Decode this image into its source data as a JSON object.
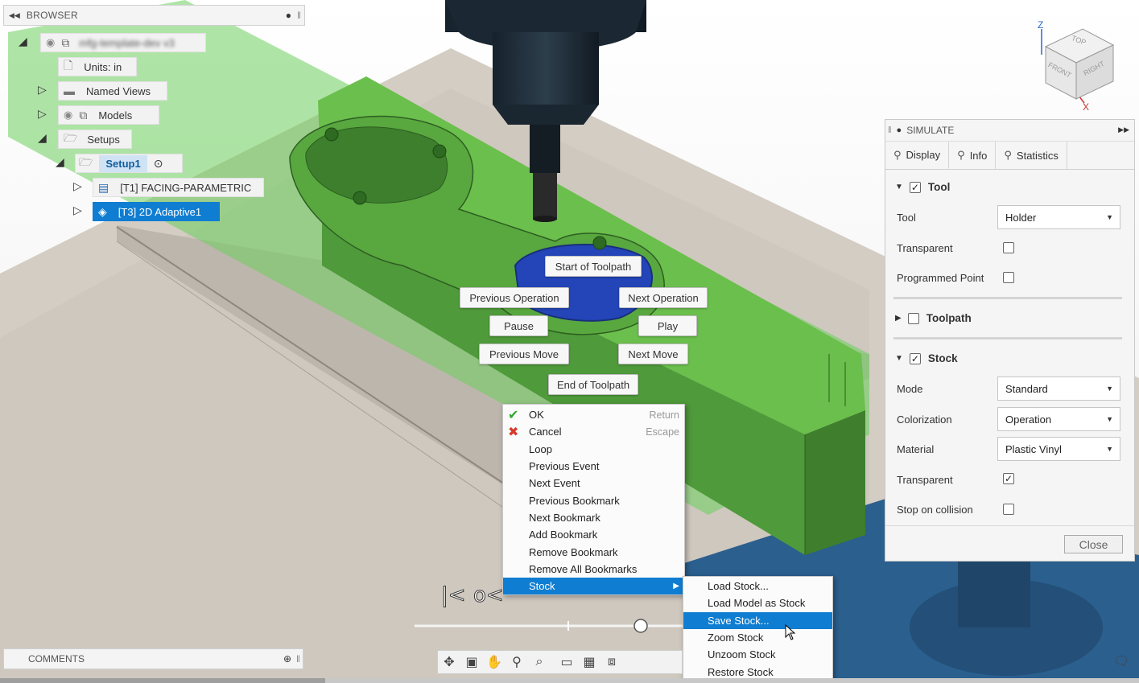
{
  "browser": {
    "title": "BROWSER",
    "root_label": "mfg-template-dev v3",
    "units_label": "Units: in",
    "named_views_label": "Named Views",
    "models_label": "Models",
    "setups_label": "Setups",
    "setup1_label": "Setup1",
    "op1_label": "[T1] FACING-PARAMETRIC",
    "op2_label": "[T3] 2D Adaptive1"
  },
  "hud": {
    "start_of_toolpath": "Start of Toolpath",
    "previous_operation": "Previous Operation",
    "next_operation": "Next Operation",
    "pause": "Pause",
    "play": "Play",
    "previous_move": "Previous Move",
    "next_move": "Next Move",
    "end_of_toolpath": "End of Toolpath"
  },
  "context_menu": {
    "items": [
      {
        "label": "OK",
        "shortcut": "Return"
      },
      {
        "label": "Cancel",
        "shortcut": "Escape"
      },
      {
        "label": "Loop"
      },
      {
        "label": "Previous Event"
      },
      {
        "label": "Next Event"
      },
      {
        "label": "Previous Bookmark"
      },
      {
        "label": "Next Bookmark"
      },
      {
        "label": "Add Bookmark"
      },
      {
        "label": "Remove Bookmark"
      },
      {
        "label": "Remove All Bookmarks"
      },
      {
        "label": "Stock"
      }
    ]
  },
  "stock_submenu": {
    "items": [
      {
        "label": "Load Stock..."
      },
      {
        "label": "Load Model as Stock"
      },
      {
        "label": "Save Stock..."
      },
      {
        "label": "Zoom Stock"
      },
      {
        "label": "Unzoom Stock"
      },
      {
        "label": "Restore Stock"
      }
    ]
  },
  "viewcube": {
    "top": "TOP",
    "front": "FRONT",
    "right": "RIGHT",
    "axis_z": "Z",
    "axis_x": "X"
  },
  "simulate": {
    "title": "SIMULATE",
    "tabs": [
      "Display",
      "Info",
      "Statistics"
    ],
    "tool_section": "Tool",
    "tool_label": "Tool",
    "tool_value": "Holder",
    "transparent_label": "Transparent",
    "programmed_point_label": "Programmed Point",
    "toolpath_section": "Toolpath",
    "stock_section": "Stock",
    "mode_label": "Mode",
    "mode_value": "Standard",
    "colorization_label": "Colorization",
    "colorization_value": "Operation",
    "material_label": "Material",
    "material_value": "Plastic Vinyl",
    "stock_transparent_label": "Transparent",
    "stop_on_collision_label": "Stop on collision",
    "close_label": "Close",
    "checks": {
      "tool": true,
      "transparent": false,
      "programmed_point": false,
      "toolpath": false,
      "stock": true,
      "stock_transparent": true,
      "stop_on_collision": false
    }
  },
  "comments": {
    "title": "COMMENTS"
  },
  "colors": {
    "accent": "#0f7dd1",
    "green_part": "#5cb84a",
    "stock_blue": "#2b5f8e"
  }
}
